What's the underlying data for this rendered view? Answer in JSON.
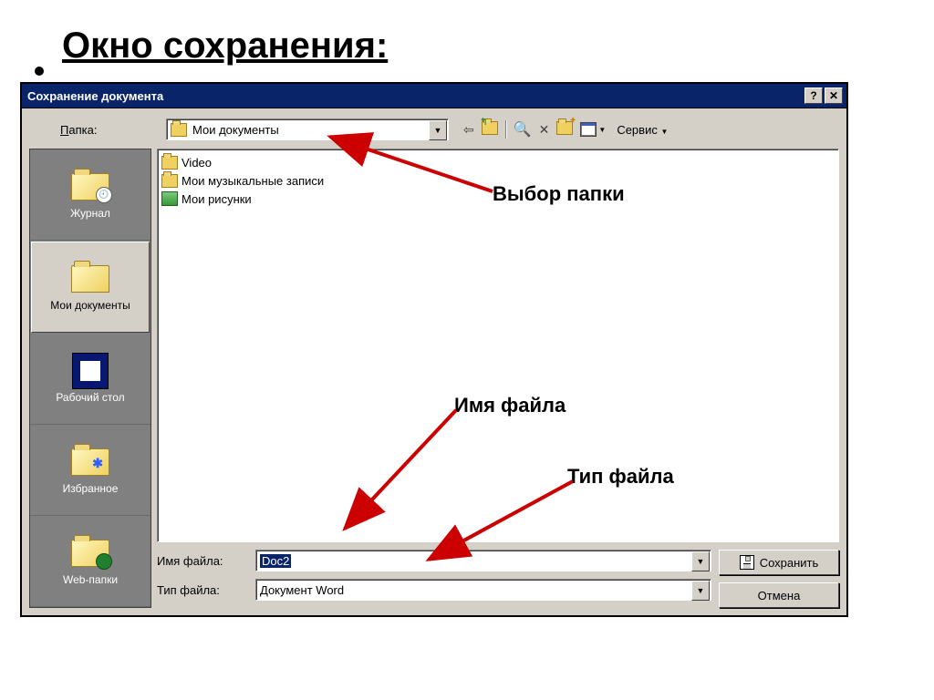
{
  "slide": {
    "title": "Окно сохранения:"
  },
  "dialog": {
    "title": "Сохранение документа",
    "help_btn": "?",
    "close_btn": "✕"
  },
  "toprow": {
    "folder_label": "Папка:",
    "folder_value": "Мои документы",
    "service_label": "Сервис"
  },
  "sidebar": {
    "items": [
      {
        "label": "Журнал"
      },
      {
        "label": "Мои документы"
      },
      {
        "label": "Рабочий стол"
      },
      {
        "label": "Избранное"
      },
      {
        "label": "Web-папки"
      }
    ]
  },
  "files": [
    {
      "name": "Video",
      "kind": "folder"
    },
    {
      "name": "Мои музыкальные записи",
      "kind": "folder"
    },
    {
      "name": "Мои рисунки",
      "kind": "picture"
    }
  ],
  "fields": {
    "name_label": "Имя файла:",
    "name_value": "Doc2",
    "type_label": "Тип файла:",
    "type_value": "Документ Word"
  },
  "buttons": {
    "save": "Сохранить",
    "cancel": "Отмена"
  },
  "annotations": {
    "folder_select": "Выбор папки",
    "filename": "Имя файла",
    "filetype": "Тип файла"
  }
}
